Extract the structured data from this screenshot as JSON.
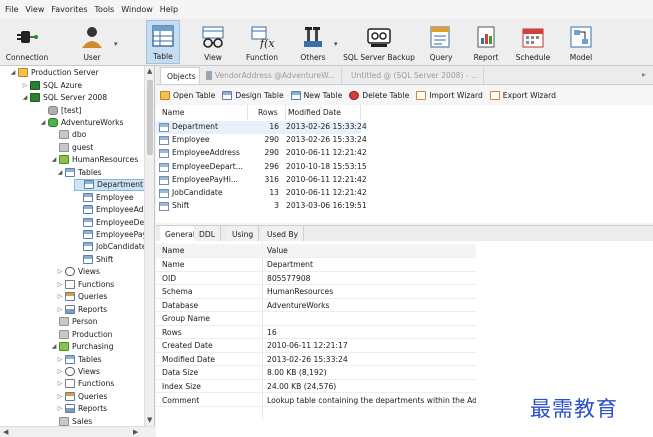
{
  "menu": [
    "File",
    "View",
    "Favorites",
    "Tools",
    "Window",
    "Help"
  ],
  "toolbar": [
    {
      "label": "Connection",
      "icon": "plug-icon"
    },
    {
      "label": "User",
      "icon": "user-icon"
    },
    {
      "label": "Table",
      "icon": "table-icon",
      "active": true
    },
    {
      "label": "View",
      "icon": "glasses-icon"
    },
    {
      "label": "Function",
      "icon": "function-icon"
    },
    {
      "label": "Others",
      "icon": "tools-icon"
    },
    {
      "label": "SQL Server Backup",
      "icon": "backup-icon"
    },
    {
      "label": "Query",
      "icon": "query-icon"
    },
    {
      "label": "Report",
      "icon": "report-icon"
    },
    {
      "label": "Schedule",
      "icon": "schedule-icon"
    },
    {
      "label": "Model",
      "icon": "model-icon"
    }
  ],
  "tree": [
    {
      "label": "Production Server",
      "level": 0,
      "exp": "down",
      "icon": "server"
    },
    {
      "label": "SQL Azure",
      "level": 1,
      "exp": "right",
      "icon": "conn"
    },
    {
      "label": "SQL Server 2008",
      "level": 1,
      "exp": "down",
      "icon": "conn"
    },
    {
      "label": "[test]",
      "level": 2,
      "exp": "",
      "icon": "db-gray"
    },
    {
      "label": "AdventureWorks",
      "level": 2,
      "exp": "down",
      "icon": "db"
    },
    {
      "label": "dbo",
      "level": 3,
      "exp": "",
      "icon": "schema"
    },
    {
      "label": "guest",
      "level": 3,
      "exp": "",
      "icon": "schema"
    },
    {
      "label": "HumanResources",
      "level": 3,
      "exp": "down",
      "icon": "schema-green"
    },
    {
      "label": "Tables",
      "level": 4,
      "exp": "down",
      "icon": "folder-table"
    },
    {
      "label": "Department",
      "level": 5,
      "exp": "",
      "icon": "table",
      "selected": true
    },
    {
      "label": "Employee",
      "level": 5,
      "exp": "",
      "icon": "table"
    },
    {
      "label": "EmployeeAddress",
      "level": 5,
      "exp": "",
      "icon": "table"
    },
    {
      "label": "EmployeeDepartmentHistory",
      "level": 5,
      "exp": "",
      "icon": "table"
    },
    {
      "label": "EmployeePayHistory",
      "level": 5,
      "exp": "",
      "icon": "table"
    },
    {
      "label": "JobCandidate",
      "level": 5,
      "exp": "",
      "icon": "table"
    },
    {
      "label": "Shift",
      "level": 5,
      "exp": "",
      "icon": "table"
    },
    {
      "label": "Views",
      "level": 4,
      "exp": "right",
      "icon": "views"
    },
    {
      "label": "Functions",
      "level": 4,
      "exp": "right",
      "icon": "functions"
    },
    {
      "label": "Queries",
      "level": 4,
      "exp": "right",
      "icon": "queries"
    },
    {
      "label": "Reports",
      "level": 4,
      "exp": "right",
      "icon": "reports"
    },
    {
      "label": "Person",
      "level": 3,
      "exp": "",
      "icon": "schema"
    },
    {
      "label": "Production",
      "level": 3,
      "exp": "",
      "icon": "schema"
    },
    {
      "label": "Purchasing",
      "level": 3,
      "exp": "down",
      "icon": "schema-green"
    },
    {
      "label": "Tables",
      "level": 4,
      "exp": "right",
      "icon": "folder-table"
    },
    {
      "label": "Views",
      "level": 4,
      "exp": "right",
      "icon": "views"
    },
    {
      "label": "Functions",
      "level": 4,
      "exp": "right",
      "icon": "functions"
    },
    {
      "label": "Queries",
      "level": 4,
      "exp": "right",
      "icon": "queries"
    },
    {
      "label": "Reports",
      "level": 4,
      "exp": "right",
      "icon": "reports"
    },
    {
      "label": "Sales",
      "level": 3,
      "exp": "",
      "icon": "schema"
    }
  ],
  "tabs": [
    {
      "label": "Objects",
      "active": true
    },
    {
      "label": "VendorAddress @AdventureW...",
      "active": false,
      "icon": "design"
    },
    {
      "label": "Untitled @ (SQL Server 2008) - ...",
      "active": false,
      "icon": "query"
    }
  ],
  "object_toolbar": [
    {
      "label": "Open Table",
      "icon": "open-table-icon"
    },
    {
      "label": "Design Table",
      "icon": "design-table-icon"
    },
    {
      "label": "New Table",
      "icon": "new-table-icon"
    },
    {
      "label": "Delete Table",
      "icon": "delete-table-icon"
    },
    {
      "label": "Import Wizard",
      "icon": "import-icon"
    },
    {
      "label": "Export Wizard",
      "icon": "export-icon"
    }
  ],
  "grid": {
    "headers": [
      "Name",
      "Rows",
      "Modified Date"
    ],
    "rows": [
      [
        "Department",
        "16",
        "2013-02-26 15:33:24"
      ],
      [
        "Employee",
        "290",
        "2013-02-26 15:33:24"
      ],
      [
        "EmployeeAddress",
        "290",
        "2010-06-11 12:21:42"
      ],
      [
        "EmployeeDepart...",
        "296",
        "2010-10-18 15:53:15"
      ],
      [
        "EmployeePayHi...",
        "316",
        "2010-06-11 12:21:42"
      ],
      [
        "JobCandidate",
        "13",
        "2010-06-11 12:21:42"
      ],
      [
        "Shift",
        "3",
        "2013-03-06 16:19:51"
      ]
    ]
  },
  "prop_tabs": [
    "General",
    "DDL",
    "Using",
    "Used By"
  ],
  "properties": {
    "headers": [
      "Name",
      "Value"
    ],
    "rows": [
      [
        "Name",
        "Department"
      ],
      [
        "OID",
        "805577908"
      ],
      [
        "Schema",
        "HumanResources"
      ],
      [
        "Database",
        "AdventureWorks"
      ],
      [
        "Group Name",
        ""
      ],
      [
        "Rows",
        "16"
      ],
      [
        "Created Date",
        "2010-06-11 12:21:17"
      ],
      [
        "Modified Date",
        "2013-02-26 15:33:24"
      ],
      [
        "Data Size",
        "8.00 KB (8,192)"
      ],
      [
        "Index Size",
        "24.00 KB (24,576)"
      ],
      [
        "Comment",
        "Lookup table containing the departments within the Adv"
      ]
    ]
  },
  "watermark": "最需教育",
  "colors": {
    "accent": "#c6dcf0",
    "selection": "#cfe3f7",
    "watermark": "#2a50c8"
  }
}
